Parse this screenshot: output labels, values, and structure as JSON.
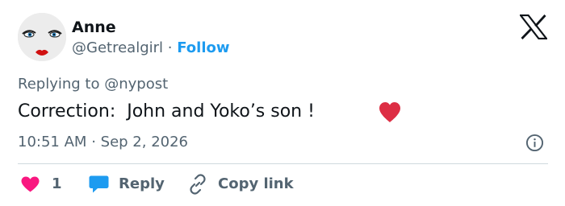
{
  "author": {
    "name": "Anne",
    "handle": "@Getrealgirl",
    "separator": "·",
    "follow_label": "Follow"
  },
  "reply_context": {
    "prefix": "Replying to",
    "mention": "@nypost"
  },
  "tweet": {
    "text": "Correction:  John and Yoko’s son !",
    "emoji": "red-heart"
  },
  "meta": {
    "time": "10:51 AM",
    "separator": "·",
    "date": "Sep 2, 2026"
  },
  "actions": {
    "like_count": "1",
    "reply_label": "Reply",
    "copy_label": "Copy link"
  },
  "icons": {
    "logo": "x-logo-icon",
    "info": "info-icon",
    "like": "heart-icon",
    "reply": "speech-bubble-icon",
    "copy": "link-icon"
  },
  "colors": {
    "accent": "#1d9bf0",
    "like": "#f91880",
    "emoji_heart": "#dd2e44",
    "text_primary": "#0f1419",
    "text_secondary": "#536471",
    "divider": "#cfd9de"
  }
}
